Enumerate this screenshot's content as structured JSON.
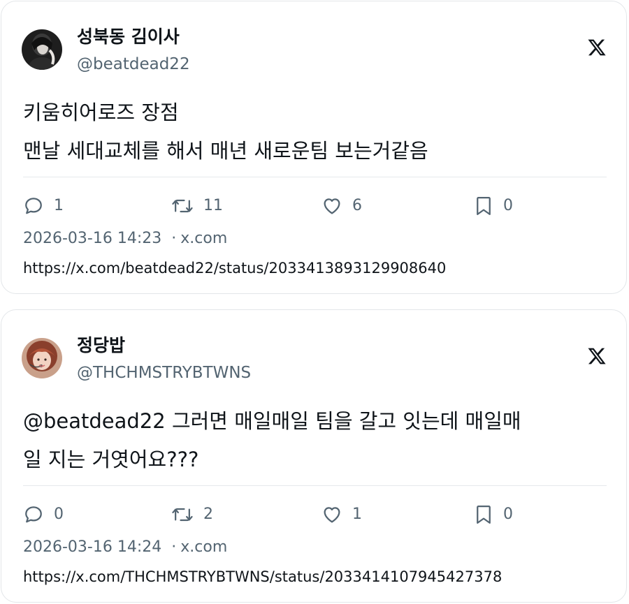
{
  "tweets": [
    {
      "display_name": "성북동 김이사",
      "handle": "@beatdead22",
      "text_lines": [
        "키움히어로즈 장점",
        "맨날 세대교체를 해서 매년 새로운팀 보는거같음"
      ],
      "stats": {
        "replies": "1",
        "retweets": "11",
        "likes": "6",
        "bookmarks": "0"
      },
      "timestamp": "2026-03-16 14:23",
      "separator": "·",
      "source": "x.com",
      "url": "https://x.com/beatdead22/status/2033413893129908640",
      "avatar_icon": "profile-photo-icon"
    },
    {
      "display_name": "정당밥",
      "handle": "@THCHMSTRYBTWNS",
      "text_lines": [
        "@beatdead22 그러면 매일매일 팀을 갈고 잇는데 매일매",
        "일 지는 거엿어요???"
      ],
      "stats": {
        "replies": "0",
        "retweets": "2",
        "likes": "1",
        "bookmarks": "0"
      },
      "timestamp": "2026-03-16 14:24",
      "separator": "·",
      "source": "x.com",
      "url": "https://x.com/THCHMSTRYBTWNS/status/2033414107945427378",
      "avatar_icon": "profile-photo-icon"
    }
  ],
  "icons": {
    "brand": "x-logo-icon",
    "reply": "reply-icon",
    "retweet": "retweet-icon",
    "like": "heart-icon",
    "bookmark": "bookmark-icon"
  },
  "colors": {
    "text_primary": "#0f1419",
    "text_secondary": "#536471",
    "border": "#e3e6e9",
    "background": "#ffffff"
  }
}
